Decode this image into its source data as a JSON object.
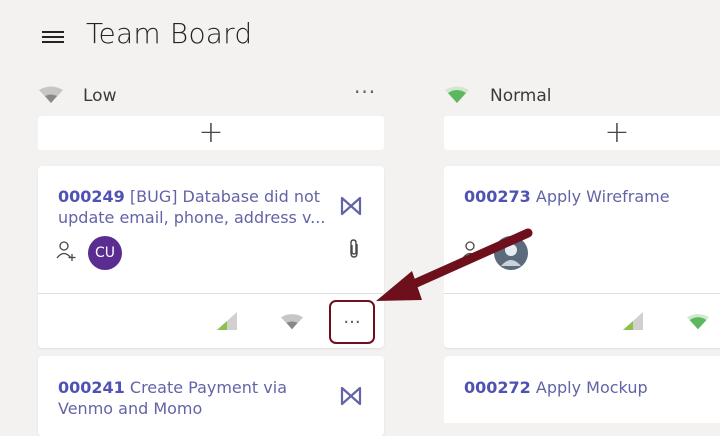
{
  "header": {
    "title": "Team Board"
  },
  "columns": [
    {
      "label": "Low",
      "more_label": "···",
      "add_label": "+",
      "cards": [
        {
          "id": "000249",
          "title": "[BUG] Database did not",
          "title_line2": "update email, phone, address v...",
          "avatar_initials": "CU",
          "more_label": "···"
        },
        {
          "id": "000241",
          "title": "Create Payment via",
          "title_line2": "Venmo and Momo"
        }
      ]
    },
    {
      "label": "Normal",
      "add_label": "+",
      "cards": [
        {
          "id": "000273",
          "title": "Apply Wireframe"
        },
        {
          "id": "000272",
          "title": "Apply Mockup"
        }
      ]
    }
  ],
  "colors": {
    "accent": "#6264a7",
    "priority_low": "#8a8886",
    "priority_normal": "#5cb85c",
    "highlight_border": "#6e0f1c",
    "arrow": "#6e0f1c"
  }
}
